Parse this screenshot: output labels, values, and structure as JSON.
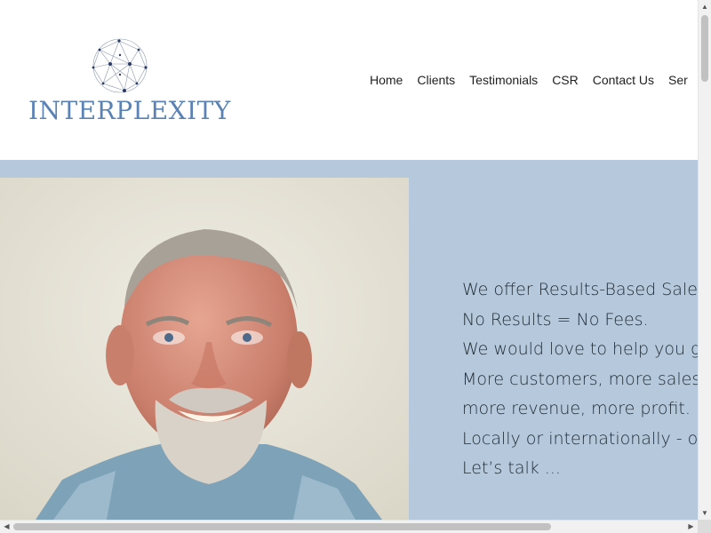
{
  "logo": {
    "text": "INTERPLEXITY",
    "icon": "network-globe-icon"
  },
  "nav": {
    "items": [
      {
        "label": "Home"
      },
      {
        "label": "Clients"
      },
      {
        "label": "Testimonials"
      },
      {
        "label": "CSR"
      },
      {
        "label": "Contact Us"
      },
      {
        "label": "Ser"
      }
    ]
  },
  "hero": {
    "photo": "portrait-of-smiling-man",
    "lines": [
      "We offer Results-Based Sale",
      "No Results = No Fees.",
      "We would love to help you g",
      "More customers, more sales",
      "more revenue, more profit.",
      "Locally or internationally - o",
      "Let’s talk ..."
    ]
  },
  "colors": {
    "hero_background": "#b6c9dc",
    "logo_text": "#5a82b4",
    "nav_text": "#1f1f1f",
    "body_text": "#1f2a33"
  }
}
